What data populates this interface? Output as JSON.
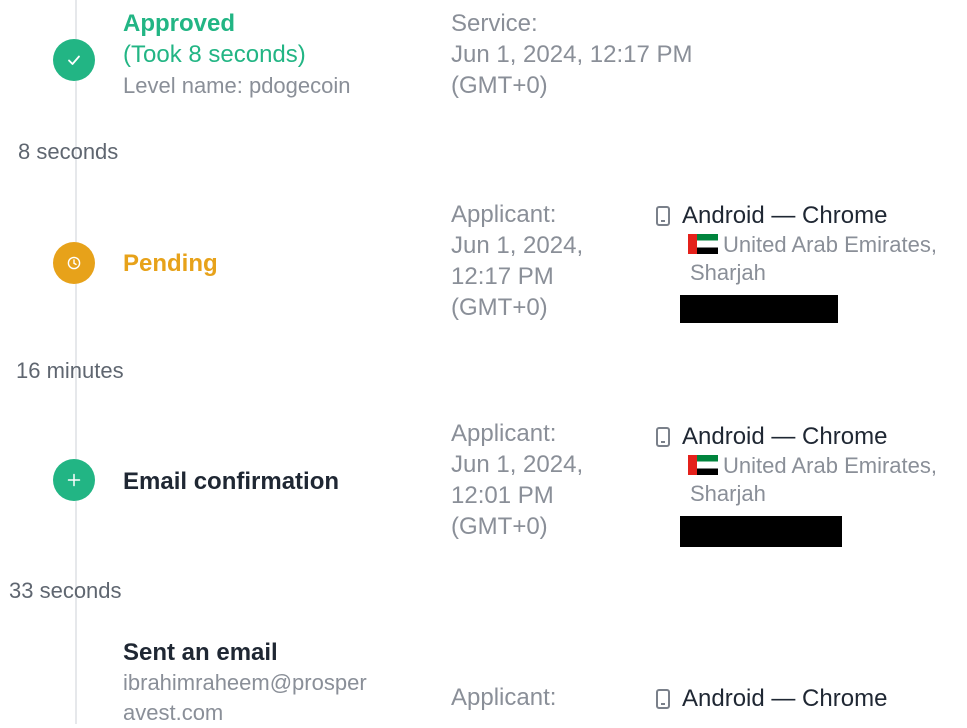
{
  "colors": {
    "approved": "#22b584",
    "pending": "#e7a21a",
    "email": "#22b584",
    "text_dark": "#1f2733",
    "text_muted": "#8a8f98"
  },
  "events": [
    {
      "status": "Approved",
      "took": "(Took 8 seconds)",
      "level": "Level name: pdogecoin",
      "icon": "check-icon",
      "meta": [
        "Service:",
        "Jun 1, 2024, 12:17 PM",
        "(GMT+0)"
      ]
    },
    {
      "status": "Pending",
      "icon": "clock-icon",
      "meta": [
        "Applicant:",
        "Jun 1, 2024,",
        "12:17 PM",
        "(GMT+0)"
      ],
      "device": "Android — Chrome",
      "location_line1": "United Arab Emirates,",
      "location_line2": "Sharjah"
    },
    {
      "status": "Email confirmation",
      "icon": "plus-icon",
      "meta": [
        "Applicant:",
        "Jun 1, 2024,",
        "12:01 PM",
        "(GMT+0)"
      ],
      "device": "Android — Chrome",
      "location_line1": "United Arab Emirates,",
      "location_line2": "Sharjah"
    },
    {
      "status": "Sent an email",
      "email_line1": "ibrahimraheem@prosper",
      "email_line2": "avest.com",
      "meta": [
        "Applicant:"
      ],
      "device": "Android — Chrome"
    }
  ],
  "durations": [
    "8 seconds",
    "16 minutes",
    "33 seconds"
  ]
}
